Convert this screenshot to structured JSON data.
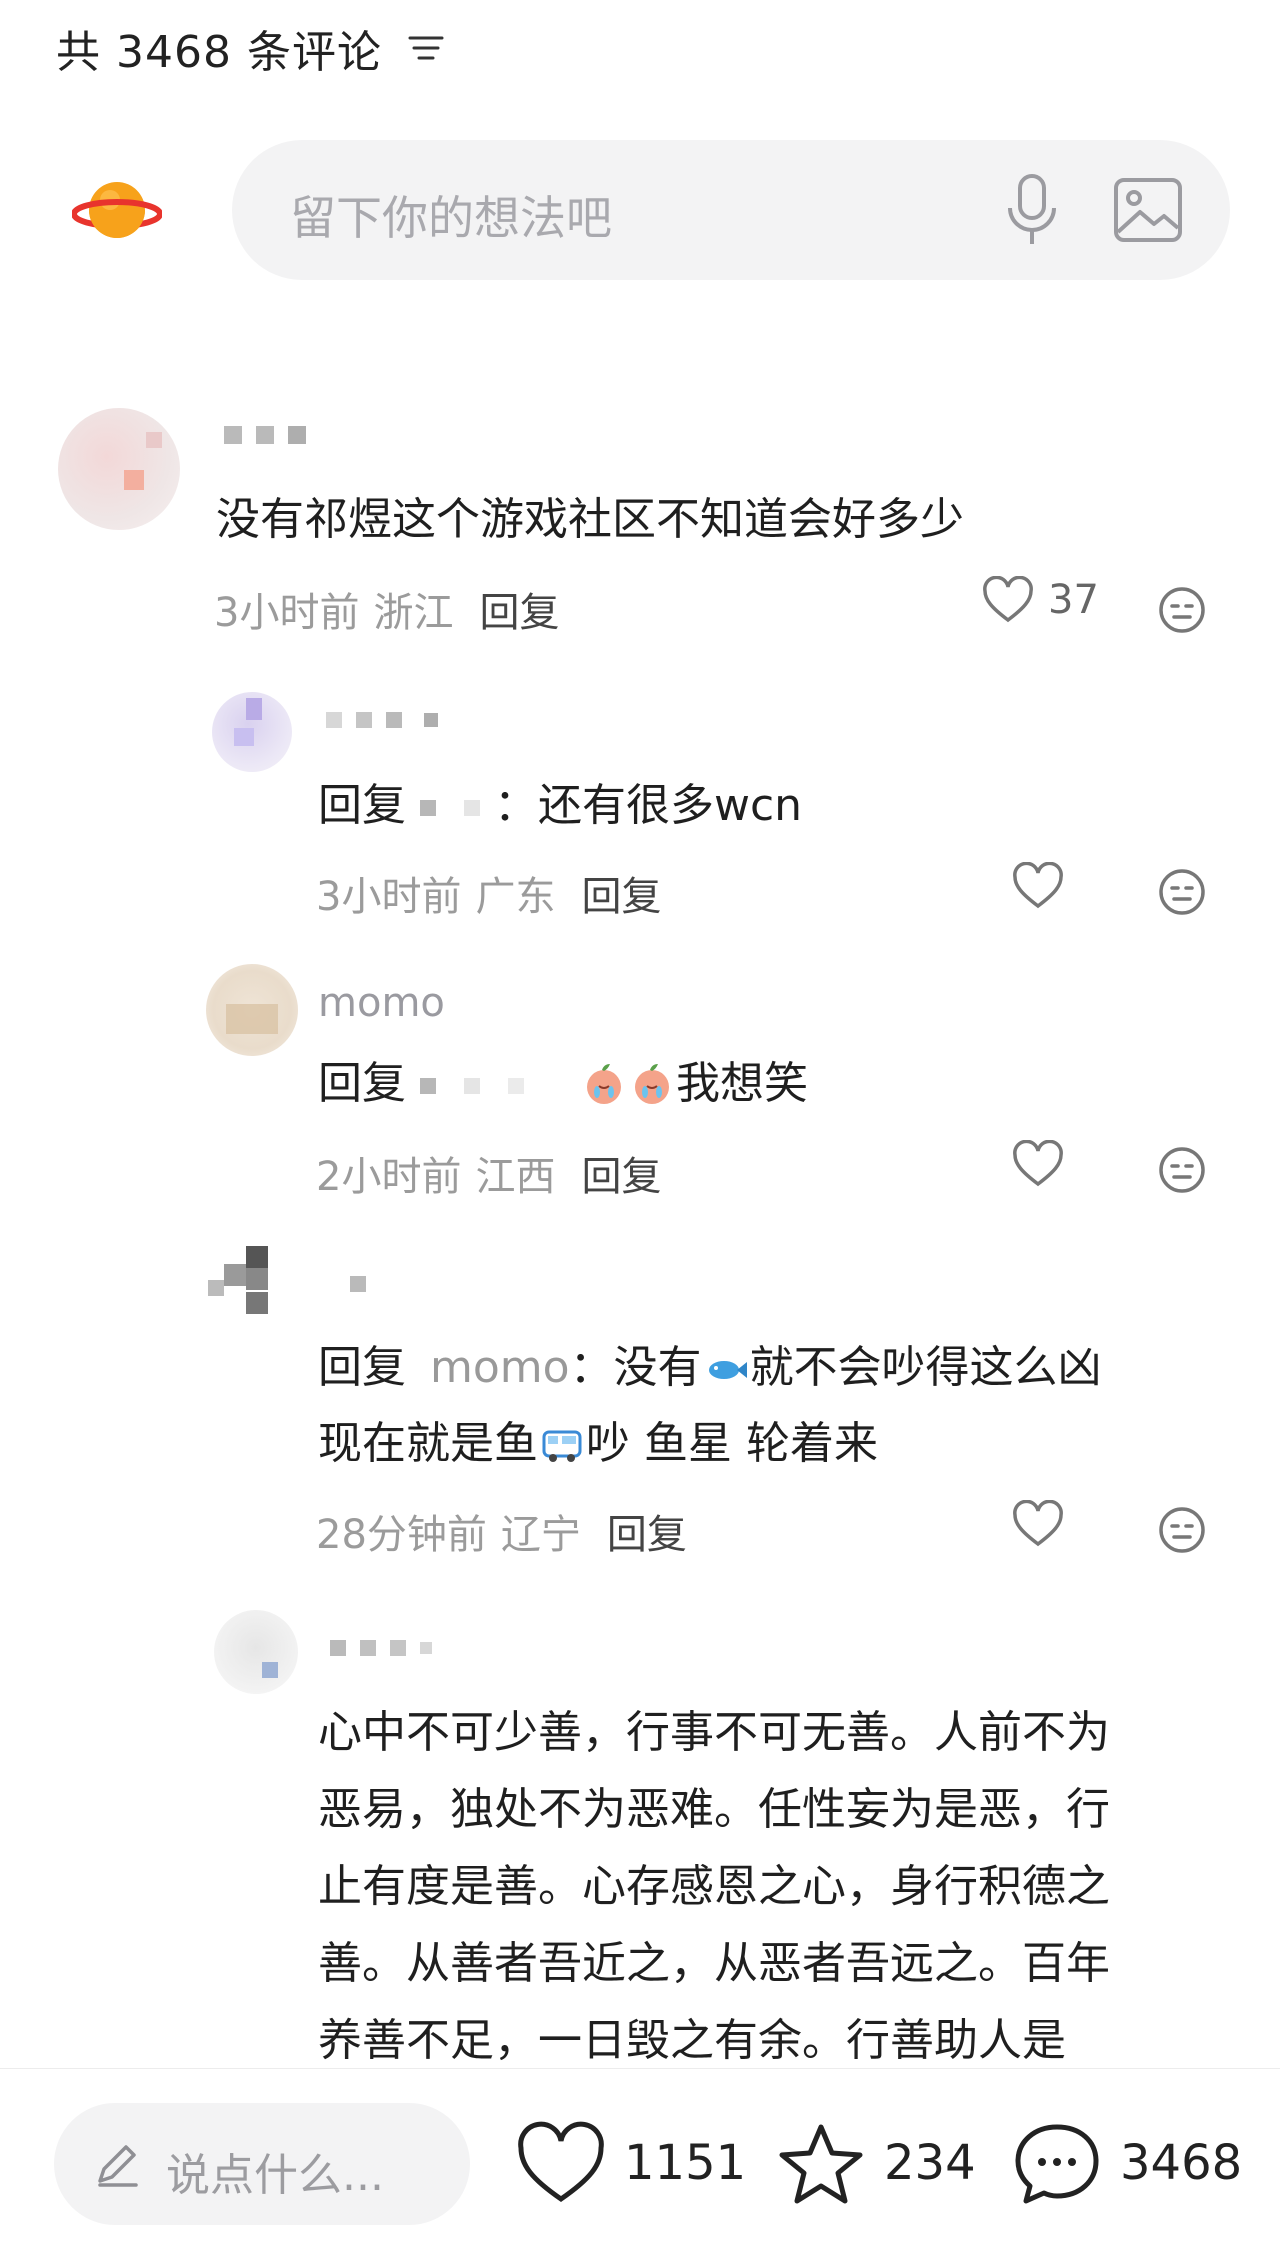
{
  "header": {
    "title": "共 3468 条评论"
  },
  "compose": {
    "placeholder": "留下你的想法吧"
  },
  "comments": [
    {
      "username": "",
      "text": "没有祁煜这个游戏社区不知道会好多少",
      "time": "3小时前",
      "location": "浙江",
      "reply_label": "回复",
      "likes": "37"
    },
    {
      "username": "",
      "reply_prefix": "回复",
      "text": "：还有很多wcn",
      "time": "3小时前",
      "location": "广东",
      "reply_label": "回复"
    },
    {
      "username": "momo",
      "reply_prefix": "回复",
      "text": "我想笑",
      "time": "2小时前",
      "location": "江西",
      "reply_label": "回复"
    },
    {
      "username": "",
      "reply_prefix": "回复",
      "mention": "momo",
      "text_a": "：没有",
      "text_b": "就不会吵得这么凶",
      "text_c": "现在就是鱼",
      "text_d": "吵 鱼星 轮着来",
      "time": "28分钟前",
      "location": "辽宁",
      "reply_label": "回复"
    },
    {
      "username": "",
      "text_lines": [
        "心中不可少善，行事不可无善。人前不为",
        "恶易，独处不为恶难。任性妄为是恶，行",
        "止有度是善。心存感恩之心，身行积德之",
        "善。从善者吾近之，从恶者吾远之。百年",
        "养善不足，一日毁之有余。行善助人是"
      ]
    }
  ],
  "bottom_bar": {
    "input_placeholder": "说点什么...",
    "likes": "1151",
    "favorites": "234",
    "comments": "3468"
  },
  "colors": {
    "accent_planet": "#f7a21b",
    "planet_ring": "#e8342d"
  }
}
